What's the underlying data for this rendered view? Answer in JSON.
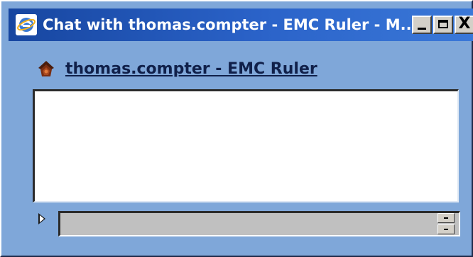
{
  "window": {
    "title": "Chat with thomas.compter - EMC Ruler - M...",
    "buttons": {
      "minimize_icon": "minimize-icon",
      "maximize_icon": "maximize-icon",
      "close_label": "X"
    }
  },
  "contact": {
    "name": "thomas.compter - EMC Ruler",
    "icon": "buddy-icon"
  },
  "chat": {
    "history_text": "",
    "input_value": "",
    "send_icon": "send-arrow-icon"
  },
  "colors": {
    "window_bg": "#7fa7d9",
    "titlebar": "#2b63c9",
    "input_bg": "#c0c0c0"
  }
}
